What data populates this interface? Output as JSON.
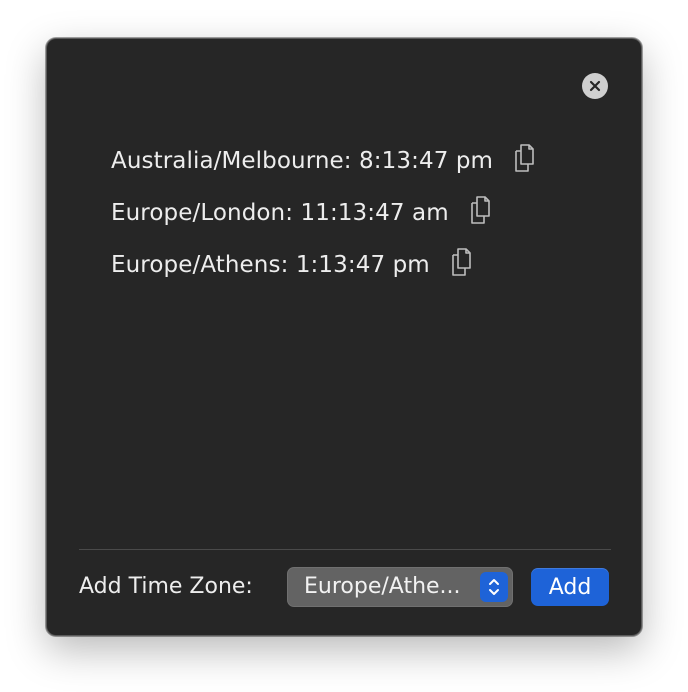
{
  "timezones": [
    {
      "label": "Australia/Melbourne: 8:13:47 pm",
      "icon": "copy-icon"
    },
    {
      "label": "Europe/London: 11:13:47 am",
      "icon": "copy-icon"
    },
    {
      "label": "Europe/Athens: 1:13:47 pm",
      "icon": "copy-icon"
    }
  ],
  "footer": {
    "label": "Add Time Zone:",
    "select_value": "Europe/Athe...",
    "add_label": "Add"
  },
  "icons": {
    "close": "close-icon",
    "stepper": "chevron-up-down-icon"
  },
  "colors": {
    "window_bg": "#262626",
    "accent": "#1e63d8",
    "text": "#ededed"
  }
}
